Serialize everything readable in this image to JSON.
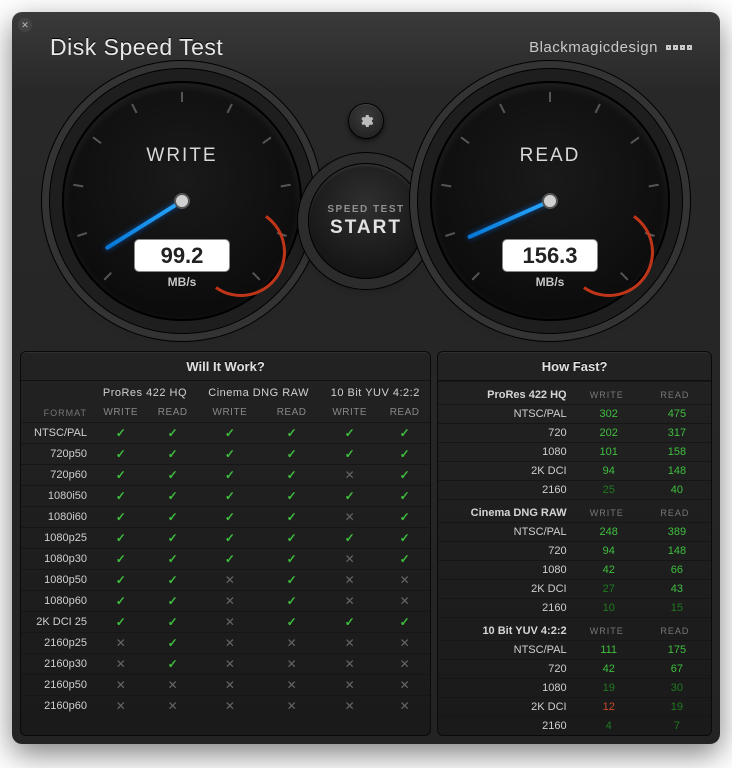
{
  "header": {
    "title": "Disk Speed Test",
    "brand": "Blackmagicdesign"
  },
  "controls": {
    "start_line1": "SPEED TEST",
    "start_line2": "START"
  },
  "gauges": {
    "unit": "MB/s",
    "write": {
      "label": "WRITE",
      "value": "99.2",
      "angle": 148
    },
    "read": {
      "label": "READ",
      "value": "156.3",
      "angle": 156
    }
  },
  "will": {
    "title": "Will It Work?",
    "format_label": "FORMAT",
    "wr_labels": {
      "write": "WRITE",
      "read": "READ"
    },
    "codecs": [
      "ProRes 422 HQ",
      "Cinema DNG RAW",
      "10 Bit YUV 4:2:2"
    ],
    "rows": [
      {
        "format": "NTSC/PAL",
        "v": [
          true,
          true,
          true,
          true,
          true,
          true
        ]
      },
      {
        "format": "720p50",
        "v": [
          true,
          true,
          true,
          true,
          true,
          true
        ]
      },
      {
        "format": "720p60",
        "v": [
          true,
          true,
          true,
          true,
          false,
          true
        ]
      },
      {
        "format": "1080i50",
        "v": [
          true,
          true,
          true,
          true,
          true,
          true
        ]
      },
      {
        "format": "1080i60",
        "v": [
          true,
          true,
          true,
          true,
          false,
          true
        ]
      },
      {
        "format": "1080p25",
        "v": [
          true,
          true,
          true,
          true,
          true,
          true
        ]
      },
      {
        "format": "1080p30",
        "v": [
          true,
          true,
          true,
          true,
          false,
          true
        ]
      },
      {
        "format": "1080p50",
        "v": [
          true,
          true,
          false,
          true,
          false,
          false
        ]
      },
      {
        "format": "1080p60",
        "v": [
          true,
          true,
          false,
          true,
          false,
          false
        ]
      },
      {
        "format": "2K DCI 25",
        "v": [
          true,
          true,
          false,
          true,
          true,
          true
        ]
      },
      {
        "format": "2160p25",
        "v": [
          false,
          true,
          false,
          false,
          false,
          false
        ]
      },
      {
        "format": "2160p30",
        "v": [
          false,
          true,
          false,
          false,
          false,
          false
        ]
      },
      {
        "format": "2160p50",
        "v": [
          false,
          false,
          false,
          false,
          false,
          false
        ]
      },
      {
        "format": "2160p60",
        "v": [
          false,
          false,
          false,
          false,
          false,
          false
        ]
      }
    ]
  },
  "fast": {
    "title": "How Fast?",
    "wr_labels": {
      "write": "WRITE",
      "read": "READ"
    },
    "sections": [
      {
        "codec": "ProRes 422 HQ",
        "rows": [
          {
            "format": "NTSC/PAL",
            "write": {
              "v": "302",
              "c": "green"
            },
            "read": {
              "v": "475",
              "c": "green"
            }
          },
          {
            "format": "720",
            "write": {
              "v": "202",
              "c": "green"
            },
            "read": {
              "v": "317",
              "c": "green"
            }
          },
          {
            "format": "1080",
            "write": {
              "v": "101",
              "c": "green"
            },
            "read": {
              "v": "158",
              "c": "green"
            }
          },
          {
            "format": "2K DCI",
            "write": {
              "v": "94",
              "c": "green"
            },
            "read": {
              "v": "148",
              "c": "green"
            }
          },
          {
            "format": "2160",
            "write": {
              "v": "25",
              "c": "dkgreen"
            },
            "read": {
              "v": "40",
              "c": "green"
            }
          }
        ]
      },
      {
        "codec": "Cinema DNG RAW",
        "rows": [
          {
            "format": "NTSC/PAL",
            "write": {
              "v": "248",
              "c": "green"
            },
            "read": {
              "v": "389",
              "c": "green"
            }
          },
          {
            "format": "720",
            "write": {
              "v": "94",
              "c": "green"
            },
            "read": {
              "v": "148",
              "c": "green"
            }
          },
          {
            "format": "1080",
            "write": {
              "v": "42",
              "c": "green"
            },
            "read": {
              "v": "66",
              "c": "green"
            }
          },
          {
            "format": "2K DCI",
            "write": {
              "v": "27",
              "c": "dkgreen"
            },
            "read": {
              "v": "43",
              "c": "green"
            }
          },
          {
            "format": "2160",
            "write": {
              "v": "10",
              "c": "dkgreen"
            },
            "read": {
              "v": "15",
              "c": "dkgreen"
            }
          }
        ]
      },
      {
        "codec": "10 Bit YUV 4:2:2",
        "rows": [
          {
            "format": "NTSC/PAL",
            "write": {
              "v": "111",
              "c": "green"
            },
            "read": {
              "v": "175",
              "c": "green"
            }
          },
          {
            "format": "720",
            "write": {
              "v": "42",
              "c": "green"
            },
            "read": {
              "v": "67",
              "c": "green"
            }
          },
          {
            "format": "1080",
            "write": {
              "v": "19",
              "c": "dkgreen"
            },
            "read": {
              "v": "30",
              "c": "dkgreen"
            }
          },
          {
            "format": "2K DCI",
            "write": {
              "v": "12",
              "c": "red"
            },
            "read": {
              "v": "19",
              "c": "dkgreen"
            }
          },
          {
            "format": "2160",
            "write": {
              "v": "4",
              "c": "dkgreen"
            },
            "read": {
              "v": "7",
              "c": "dkgreen"
            }
          }
        ]
      }
    ]
  }
}
